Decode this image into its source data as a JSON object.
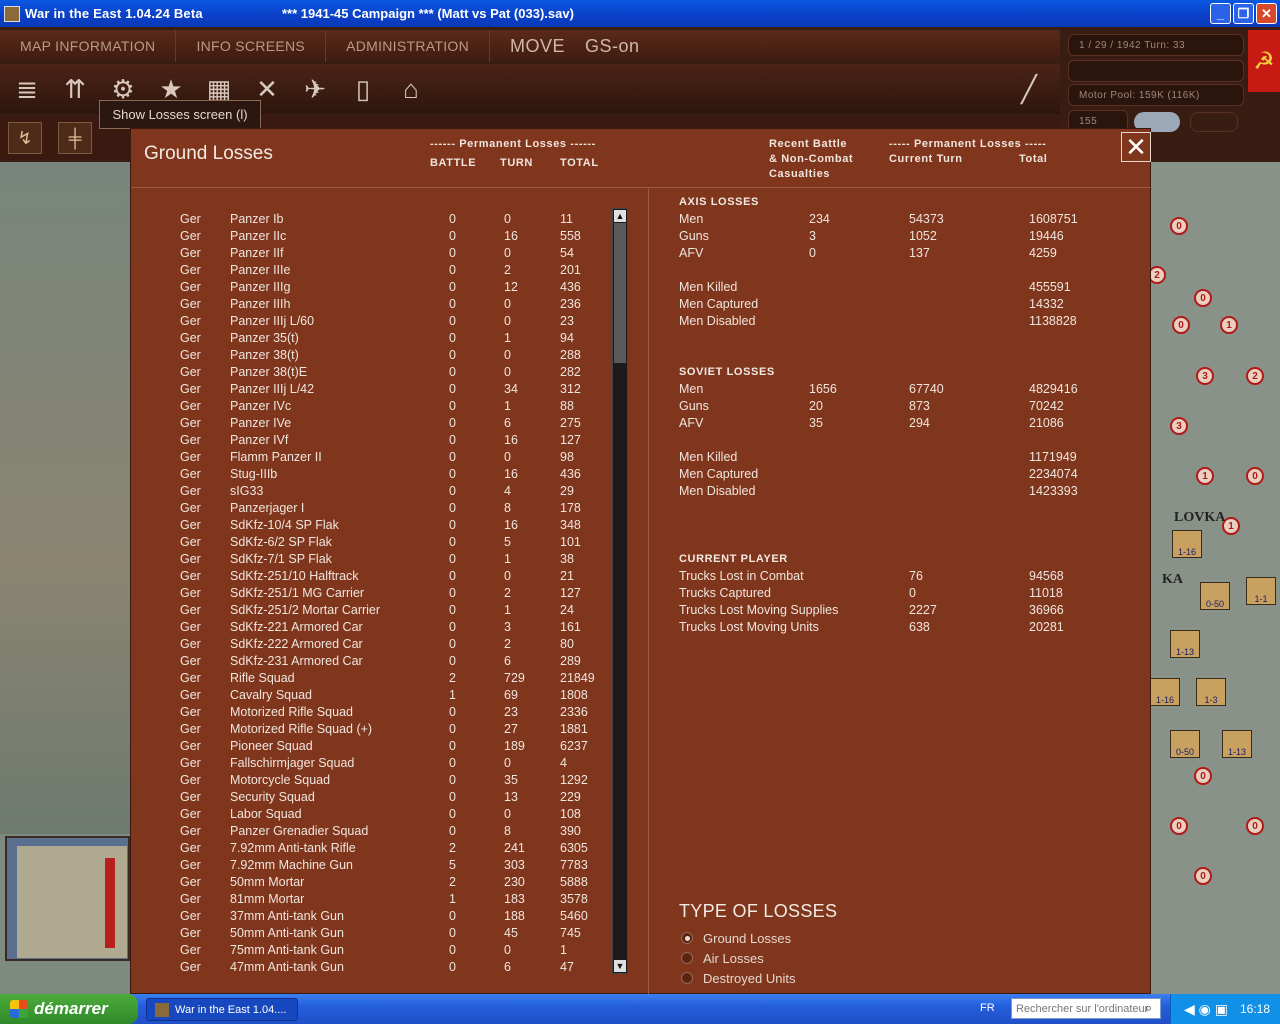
{
  "window": {
    "title": "War in the East 1.04.24 Beta",
    "subtitle": "***   1941-45 Campaign   ***  (Matt vs Pat (033).sav)"
  },
  "menu": {
    "map_information": "MAP INFORMATION",
    "info_screens": "INFO SCREENS",
    "administration": "ADMINISTRATION",
    "mode": "MOVE",
    "gs": "GS-on"
  },
  "status": {
    "date_turn": "1 / 29 / 1942     Turn: 33",
    "motor_pool": "Motor Pool:  159K (116K)",
    "value_155": "155"
  },
  "tooltip": "Show Losses screen (l)",
  "panel": {
    "title": "Ground Losses",
    "left_header_group": "------ Permanent Losses ------",
    "col_battle": "BATTLE",
    "col_turn": "TURN",
    "col_total": "TOTAL",
    "right_header_recent": "Recent Battle\n& Non-Combat\nCasualties",
    "right_header_group": "----- Permanent Losses -----",
    "right_col_current": "Current Turn",
    "right_col_total": "Total"
  },
  "ground_losses": [
    {
      "side": "Ger",
      "unit": "Panzer Ib",
      "battle": "0",
      "turn": "0",
      "total": "11"
    },
    {
      "side": "Ger",
      "unit": "Panzer IIc",
      "battle": "0",
      "turn": "16",
      "total": "558"
    },
    {
      "side": "Ger",
      "unit": "Panzer IIf",
      "battle": "0",
      "turn": "0",
      "total": "54"
    },
    {
      "side": "Ger",
      "unit": "Panzer IIIe",
      "battle": "0",
      "turn": "2",
      "total": "201"
    },
    {
      "side": "Ger",
      "unit": "Panzer IIIg",
      "battle": "0",
      "turn": "12",
      "total": "436"
    },
    {
      "side": "Ger",
      "unit": "Panzer IIIh",
      "battle": "0",
      "turn": "0",
      "total": "236"
    },
    {
      "side": "Ger",
      "unit": "Panzer IIIj L/60",
      "battle": "0",
      "turn": "0",
      "total": "23"
    },
    {
      "side": "Ger",
      "unit": "Panzer 35(t)",
      "battle": "0",
      "turn": "1",
      "total": "94"
    },
    {
      "side": "Ger",
      "unit": "Panzer 38(t)",
      "battle": "0",
      "turn": "0",
      "total": "288"
    },
    {
      "side": "Ger",
      "unit": "Panzer 38(t)E",
      "battle": "0",
      "turn": "0",
      "total": "282"
    },
    {
      "side": "Ger",
      "unit": "Panzer IIIj L/42",
      "battle": "0",
      "turn": "34",
      "total": "312"
    },
    {
      "side": "Ger",
      "unit": "Panzer IVc",
      "battle": "0",
      "turn": "1",
      "total": "88"
    },
    {
      "side": "Ger",
      "unit": "Panzer IVe",
      "battle": "0",
      "turn": "6",
      "total": "275"
    },
    {
      "side": "Ger",
      "unit": "Panzer IVf",
      "battle": "0",
      "turn": "16",
      "total": "127"
    },
    {
      "side": "Ger",
      "unit": "Flamm Panzer II",
      "battle": "0",
      "turn": "0",
      "total": "98"
    },
    {
      "side": "Ger",
      "unit": "Stug-IIIb",
      "battle": "0",
      "turn": "16",
      "total": "436"
    },
    {
      "side": "Ger",
      "unit": "sIG33",
      "battle": "0",
      "turn": "4",
      "total": "29"
    },
    {
      "side": "Ger",
      "unit": "Panzerjager I",
      "battle": "0",
      "turn": "8",
      "total": "178"
    },
    {
      "side": "Ger",
      "unit": "SdKfz-10/4 SP Flak",
      "battle": "0",
      "turn": "16",
      "total": "348"
    },
    {
      "side": "Ger",
      "unit": "SdKfz-6/2 SP Flak",
      "battle": "0",
      "turn": "5",
      "total": "101"
    },
    {
      "side": "Ger",
      "unit": "SdKfz-7/1 SP Flak",
      "battle": "0",
      "turn": "1",
      "total": "38"
    },
    {
      "side": "Ger",
      "unit": "SdKfz-251/10 Halftrack",
      "battle": "0",
      "turn": "0",
      "total": "21"
    },
    {
      "side": "Ger",
      "unit": "SdKfz-251/1 MG Carrier",
      "battle": "0",
      "turn": "2",
      "total": "127"
    },
    {
      "side": "Ger",
      "unit": "SdKfz-251/2 Mortar Carrier",
      "battle": "0",
      "turn": "1",
      "total": "24"
    },
    {
      "side": "Ger",
      "unit": "SdKfz-221 Armored Car",
      "battle": "0",
      "turn": "3",
      "total": "161"
    },
    {
      "side": "Ger",
      "unit": "SdKfz-222 Armored Car",
      "battle": "0",
      "turn": "2",
      "total": "80"
    },
    {
      "side": "Ger",
      "unit": "SdKfz-231 Armored Car",
      "battle": "0",
      "turn": "6",
      "total": "289"
    },
    {
      "side": "Ger",
      "unit": "Rifle Squad",
      "battle": "2",
      "turn": "729",
      "total": "21849"
    },
    {
      "side": "Ger",
      "unit": "Cavalry Squad",
      "battle": "1",
      "turn": "69",
      "total": "1808"
    },
    {
      "side": "Ger",
      "unit": "Motorized Rifle Squad",
      "battle": "0",
      "turn": "23",
      "total": "2336"
    },
    {
      "side": "Ger",
      "unit": "Motorized Rifle Squad (+)",
      "battle": "0",
      "turn": "27",
      "total": "1881"
    },
    {
      "side": "Ger",
      "unit": "Pioneer Squad",
      "battle": "0",
      "turn": "189",
      "total": "6237"
    },
    {
      "side": "Ger",
      "unit": "Fallschirmjager Squad",
      "battle": "0",
      "turn": "0",
      "total": "4"
    },
    {
      "side": "Ger",
      "unit": "Motorcycle Squad",
      "battle": "0",
      "turn": "35",
      "total": "1292"
    },
    {
      "side": "Ger",
      "unit": "Security Squad",
      "battle": "0",
      "turn": "13",
      "total": "229"
    },
    {
      "side": "Ger",
      "unit": "Labor Squad",
      "battle": "0",
      "turn": "0",
      "total": "108"
    },
    {
      "side": "Ger",
      "unit": "Panzer Grenadier Squad",
      "battle": "0",
      "turn": "8",
      "total": "390"
    },
    {
      "side": "Ger",
      "unit": "7.92mm Anti-tank Rifle",
      "battle": "2",
      "turn": "241",
      "total": "6305"
    },
    {
      "side": "Ger",
      "unit": "7.92mm Machine Gun",
      "battle": "5",
      "turn": "303",
      "total": "7783"
    },
    {
      "side": "Ger",
      "unit": "50mm Mortar",
      "battle": "2",
      "turn": "230",
      "total": "5888"
    },
    {
      "side": "Ger",
      "unit": "81mm Mortar",
      "battle": "1",
      "turn": "183",
      "total": "3578"
    },
    {
      "side": "Ger",
      "unit": "37mm Anti-tank Gun",
      "battle": "0",
      "turn": "188",
      "total": "5460"
    },
    {
      "side": "Ger",
      "unit": "50mm Anti-tank Gun",
      "battle": "0",
      "turn": "45",
      "total": "745"
    },
    {
      "side": "Ger",
      "unit": "75mm Anti-tank Gun",
      "battle": "0",
      "turn": "0",
      "total": "1"
    },
    {
      "side": "Ger",
      "unit": "47mm Anti-tank Gun",
      "battle": "0",
      "turn": "6",
      "total": "47"
    }
  ],
  "summary": {
    "axis": {
      "heading": "AXIS LOSSES",
      "rows": [
        {
          "label": "Men",
          "recent": "234",
          "current": "54373",
          "total": "1608751"
        },
        {
          "label": "Guns",
          "recent": "3",
          "current": "1052",
          "total": "19446"
        },
        {
          "label": "AFV",
          "recent": "0",
          "current": "137",
          "total": "4259"
        }
      ],
      "detail": [
        {
          "label": "Men Killed",
          "total": "455591"
        },
        {
          "label": "Men Captured",
          "total": "14332"
        },
        {
          "label": "Men Disabled",
          "total": "1138828"
        }
      ]
    },
    "soviet": {
      "heading": "SOVIET LOSSES",
      "rows": [
        {
          "label": "Men",
          "recent": "1656",
          "current": "67740",
          "total": "4829416"
        },
        {
          "label": "Guns",
          "recent": "20",
          "current": "873",
          "total": "70242"
        },
        {
          "label": "AFV",
          "recent": "35",
          "current": "294",
          "total": "21086"
        }
      ],
      "detail": [
        {
          "label": "Men Killed",
          "total": "1171949"
        },
        {
          "label": "Men Captured",
          "total": "2234074"
        },
        {
          "label": "Men Disabled",
          "total": "1423393"
        }
      ]
    },
    "player": {
      "heading": "CURRENT PLAYER",
      "rows": [
        {
          "label": "Trucks Lost in Combat",
          "current": "76",
          "total": "94568"
        },
        {
          "label": "Trucks Captured",
          "current": "0",
          "total": "11018"
        },
        {
          "label": "Trucks Lost Moving Supplies",
          "current": "2227",
          "total": "36966"
        },
        {
          "label": "Trucks Lost Moving Units",
          "current": "638",
          "total": "20281"
        }
      ]
    }
  },
  "type_of_losses": {
    "title": "TYPE OF LOSSES",
    "options": [
      {
        "label": "Ground Losses",
        "selected": true
      },
      {
        "label": "Air Losses",
        "selected": false
      },
      {
        "label": "Destroyed Units",
        "selected": false
      }
    ]
  },
  "map_labels": {
    "unit_1": "1-16",
    "unit_2": "0-50",
    "unit_3": "1-1",
    "unit_4": "1-13",
    "unit_5": "1-16",
    "unit_6": "1-3",
    "unit_7": "0-50",
    "unit_8": "1-13",
    "town_1": "LOVKA",
    "town_2": "KA"
  },
  "taskbar": {
    "start": "démarrer",
    "task": "War in the East 1.04....",
    "lang": "FR",
    "search_placeholder": "Rechercher sur l'ordinateur",
    "clock": "16:18"
  },
  "colors": {
    "panel_bg": "#80351d",
    "titlebar": "#0b3fc7",
    "soviet_red": "#c61a12"
  }
}
